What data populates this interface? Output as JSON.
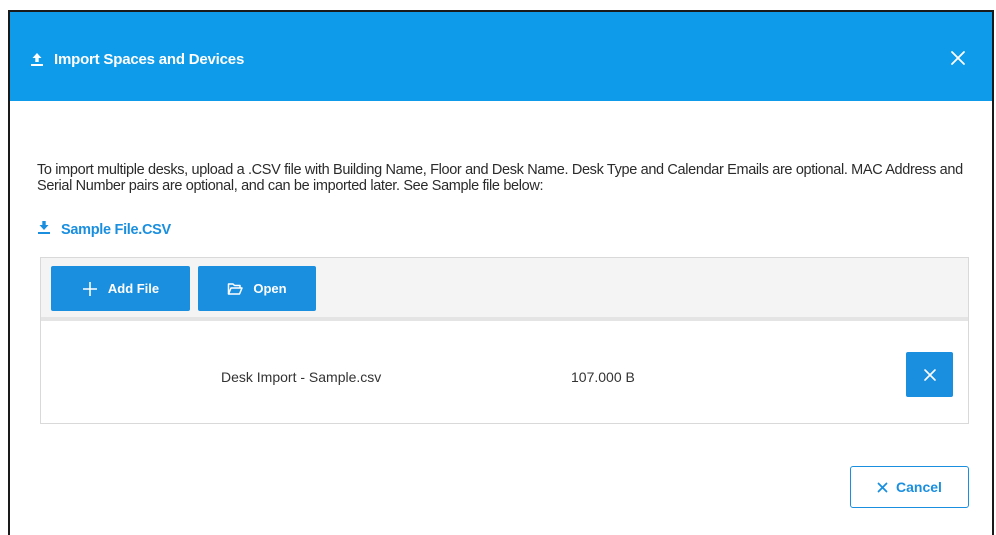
{
  "dialog": {
    "title": "Import Spaces and Devices",
    "close_icon": "close-icon",
    "title_icon": "upload-icon"
  },
  "description": "To import multiple desks, upload a .CSV file with Building Name, Floor and Desk Name. Desk Type and Calendar Emails are optional. MAC Address and Serial Number pairs are optional, and can be imported later. See Sample file below:",
  "sample_link": {
    "label": "Sample File.CSV",
    "icon": "download-icon"
  },
  "toolbar": {
    "add_file_label": "Add File",
    "add_file_icon": "plus-icon",
    "open_label": "Open",
    "open_icon": "folder-open-icon"
  },
  "files": [
    {
      "name": "Desk Import - Sample.csv",
      "size": "107.000 B"
    }
  ],
  "footer": {
    "cancel_label": "Cancel",
    "cancel_icon": "close-icon"
  },
  "colors": {
    "header_bg": "#0e9bea",
    "accent": "#1a8fe0"
  }
}
